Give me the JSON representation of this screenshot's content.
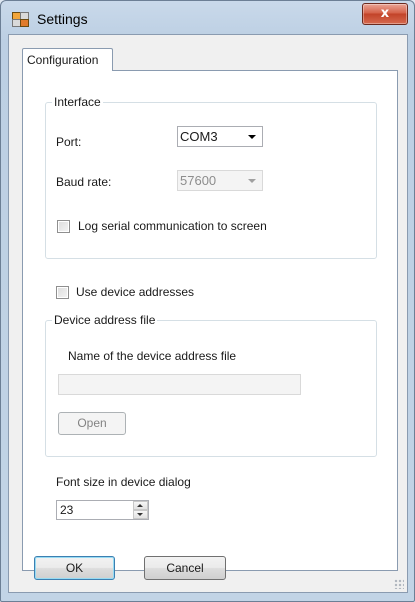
{
  "window": {
    "title": "Settings",
    "close_glyph": "x"
  },
  "tabs": [
    {
      "label": "Configuration",
      "selected": true
    }
  ],
  "interface_group": {
    "title": "Interface",
    "port_label": "Port:",
    "port_value": "COM3",
    "baud_label": "Baud rate:",
    "baud_value": "57600",
    "baud_enabled": false,
    "log_label": "Log serial communication to screen",
    "log_checked": false
  },
  "use_device_addresses": {
    "label": "Use device addresses",
    "checked": false
  },
  "device_file_group": {
    "title": "Device address file",
    "name_label": "Name of the device address file",
    "file_value": "",
    "open_label": "Open"
  },
  "font_size": {
    "label": "Font size in device dialog",
    "value": "23"
  },
  "footer": {
    "ok_label": "OK",
    "cancel_label": "Cancel"
  },
  "icons": [
    "app-icon",
    "close-icon",
    "dropdown-arrow-icon",
    "spin-up-icon",
    "spin-down-icon",
    "resize-grip-icon"
  ]
}
